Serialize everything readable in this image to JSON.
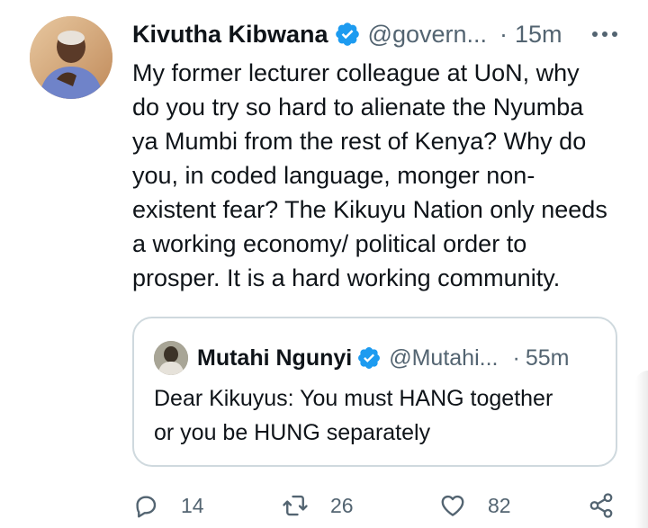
{
  "tweet": {
    "author_name": "Kivutha Kibwana",
    "author_handle": "@govern...",
    "separator": "·",
    "time": "15m",
    "more_icon": "more-horizontal-icon",
    "text": "My former lecturer colleague at UoN, why\ndo you try so hard to alienate the Nyumba\nya Mumbi from the rest of Kenya? Why do\nyou, in coded language, monger non-\nexistent fear? The Kikuyu Nation only needs\na working economy/ political order to\nprosper. It is a hard working community."
  },
  "quote": {
    "author_name": "Mutahi Ngunyi",
    "author_handle": "@Mutahi...",
    "separator": "·",
    "time": "55m",
    "text": "Dear Kikuyus: You must HANG together\nor you be HUNG separately"
  },
  "actions": {
    "reply_count": "14",
    "retweet_count": "26",
    "like_count": "82"
  },
  "colors": {
    "verified_blue": "#1d9bf0",
    "muted_text": "#536471",
    "border": "#cfd9de"
  }
}
